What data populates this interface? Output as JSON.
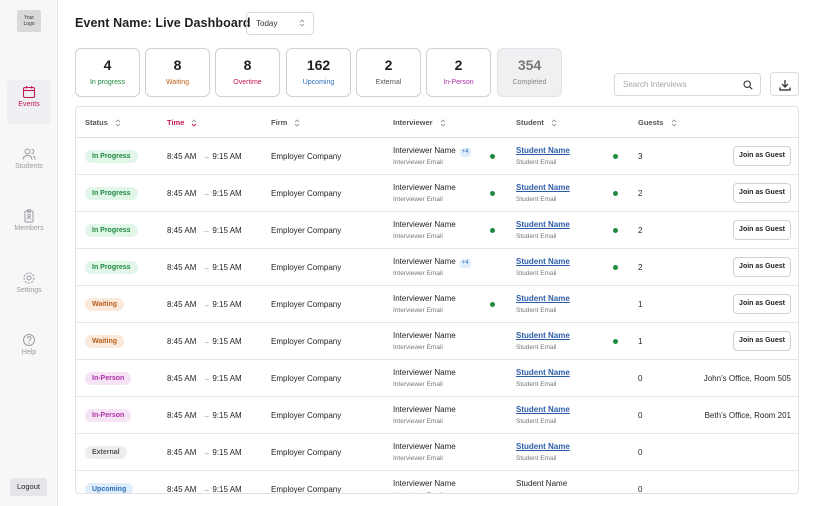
{
  "sidebar": {
    "logo_line1": "Your",
    "logo_line2": "Logo",
    "items": [
      {
        "label": "Events",
        "icon": "calendar-icon",
        "active": true
      },
      {
        "label": "Students",
        "icon": "users-icon",
        "active": false
      },
      {
        "label": "Members",
        "icon": "badge-icon",
        "active": false
      },
      {
        "label": "Settings",
        "icon": "gear-icon",
        "active": false
      },
      {
        "label": "Help",
        "icon": "help-icon",
        "active": false
      }
    ],
    "logout_label": "Logout"
  },
  "header": {
    "title": "Event  Name: Live Dashboard",
    "date_filter": "Today"
  },
  "stats": [
    {
      "count": "4",
      "label": "In progress",
      "color": "#1e8a3f"
    },
    {
      "count": "8",
      "label": "Waiting",
      "color": "#b8601e"
    },
    {
      "count": "8",
      "label": "Overtime",
      "color": "#c21a4e"
    },
    {
      "count": "162",
      "label": "Upcoming",
      "color": "#2d6fbd"
    },
    {
      "count": "2",
      "label": "External",
      "color": "#555555"
    },
    {
      "count": "2",
      "label": "In-Person",
      "color": "#b02fa9"
    },
    {
      "count": "354",
      "label": "Completed",
      "color": "#888888"
    }
  ],
  "search": {
    "placeholder": "Search Interviews"
  },
  "table": {
    "columns": [
      "Status",
      "Time",
      "Firm",
      "Interviewer",
      "Student",
      "Guests"
    ],
    "sorted_column": "Time",
    "rows": [
      {
        "status": "In Progress",
        "status_class": "s-progress",
        "start": "8:45 AM",
        "end": "9:15 AM",
        "firm": "Employer Company",
        "interviewer": "Interviewer Name",
        "interviewer_extra": "+4",
        "interviewer_email": "Interviewer Email",
        "interviewer_online": true,
        "student": "Student Name",
        "student_email": "Student Email",
        "student_online": true,
        "guests": "3",
        "action": "Join as Guest",
        "location": ""
      },
      {
        "status": "In Progress",
        "status_class": "s-progress",
        "start": "8:45 AM",
        "end": "9:15 AM",
        "firm": "Employer Company",
        "interviewer": "Interviewer Name",
        "interviewer_extra": "",
        "interviewer_email": "Interviewer Email",
        "interviewer_online": true,
        "student": "Student Name",
        "student_email": "Student Email",
        "student_online": true,
        "guests": "2",
        "action": "Join as Guest",
        "location": ""
      },
      {
        "status": "In Progress",
        "status_class": "s-progress",
        "start": "8:45 AM",
        "end": "9:15 AM",
        "firm": "Employer Company",
        "interviewer": "Interviewer Name",
        "interviewer_extra": "",
        "interviewer_email": "Interviewer Email",
        "interviewer_online": true,
        "student": "Student Name",
        "student_email": "Student Email",
        "student_online": true,
        "guests": "2",
        "action": "Join as Guest",
        "location": ""
      },
      {
        "status": "In Progress",
        "status_class": "s-progress",
        "start": "8:45 AM",
        "end": "9:15 AM",
        "firm": "Employer Company",
        "interviewer": "Interviewer Name",
        "interviewer_extra": "+4",
        "interviewer_email": "Interviewer Email",
        "interviewer_online": false,
        "student": "Student Name",
        "student_email": "Student Email",
        "student_online": true,
        "guests": "2",
        "action": "Join as Guest",
        "location": ""
      },
      {
        "status": "Waiting",
        "status_class": "s-waiting",
        "start": "8:45 AM",
        "end": "9:15 AM",
        "firm": "Employer Company",
        "interviewer": "Interviewer Name",
        "interviewer_extra": "",
        "interviewer_email": "Interviewer Email",
        "interviewer_online": true,
        "student": "Student Name",
        "student_email": "Student Email",
        "student_online": false,
        "guests": "1",
        "action": "Join as Guest",
        "location": ""
      },
      {
        "status": "Waiting",
        "status_class": "s-waiting",
        "start": "8:45 AM",
        "end": "9:15 AM",
        "firm": "Employer Company",
        "interviewer": "Interviewer Name",
        "interviewer_extra": "",
        "interviewer_email": "Interviewer Email",
        "interviewer_online": false,
        "student": "Student Name",
        "student_email": "Student Email",
        "student_online": true,
        "guests": "1",
        "action": "Join as Guest",
        "location": ""
      },
      {
        "status": "In-Person",
        "status_class": "s-inperson",
        "start": "8:45 AM",
        "end": "9:15 AM",
        "firm": "Employer Company",
        "interviewer": "Interviewer Name",
        "interviewer_extra": "",
        "interviewer_email": "Interviewer Email",
        "interviewer_online": false,
        "student": "Student Name",
        "student_email": "Student Email",
        "student_online": false,
        "guests": "0",
        "action": "",
        "location": "John’s Office, Room 505"
      },
      {
        "status": "In-Person",
        "status_class": "s-inperson",
        "start": "8:45 AM",
        "end": "9:15 AM",
        "firm": "Employer Company",
        "interviewer": "Interviewer Name",
        "interviewer_extra": "",
        "interviewer_email": "Interviewer Email",
        "interviewer_online": false,
        "student": "Student Name",
        "student_email": "Student Email",
        "student_online": false,
        "guests": "0",
        "action": "",
        "location": "Beth’s Office, Room 201"
      },
      {
        "status": "External",
        "status_class": "s-external",
        "start": "8:45 AM",
        "end": "9:15 AM",
        "firm": "Employer Company",
        "interviewer": "Interviewer Name",
        "interviewer_extra": "",
        "interviewer_email": "Interviewer Email",
        "interviewer_online": false,
        "student": "Student Name",
        "student_email": "Student Email",
        "student_online": false,
        "guests": "0",
        "action": "",
        "location": ""
      },
      {
        "status": "Upcoming",
        "status_class": "s-upcoming",
        "start": "8:45 AM",
        "end": "9:15 AM",
        "firm": "Employer Company",
        "interviewer": "Interviewer Name",
        "interviewer_extra": "",
        "interviewer_email": "Interviewer Email",
        "interviewer_online": false,
        "student": "Student Name",
        "student_email": "",
        "student_online": false,
        "student_plain": true,
        "guests": "0",
        "action": "",
        "location": ""
      }
    ]
  }
}
